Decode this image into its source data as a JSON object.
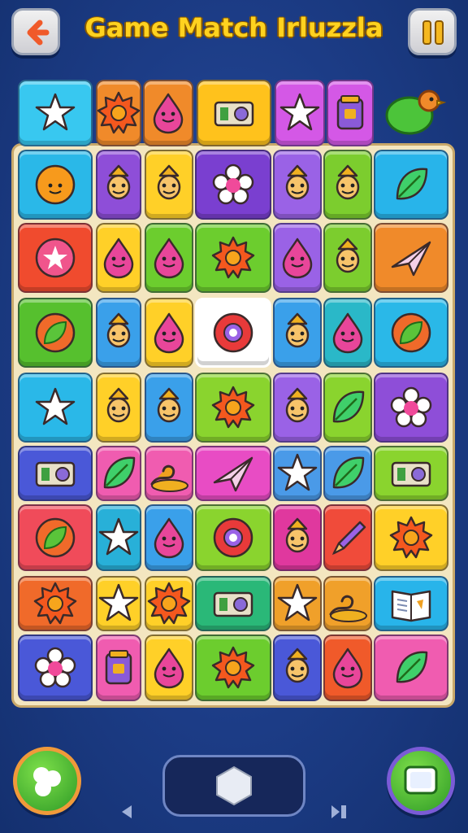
{
  "header": {
    "title": "Game Match Irluzzla",
    "back_icon": "back-arrow-icon",
    "pause_icon": "pause-icon"
  },
  "colors": {
    "background": "#1c3c86",
    "title": "#ffd21f",
    "board": "#f3e6c0"
  },
  "tiles": [
    {
      "row": 0,
      "items": [
        {
          "color": "#38c8f0",
          "icon": "star"
        },
        {
          "color": "#f08a2a",
          "icon": "sun"
        },
        {
          "color": "#f08a2a",
          "icon": "drop"
        },
        {
          "color": "#ffc21c",
          "icon": "camera"
        },
        {
          "color": "#d458e6",
          "icon": "star"
        },
        {
          "color": "#d458e6",
          "icon": "jar"
        }
      ]
    },
    {
      "row": 1,
      "items": [
        {
          "color": "#2ab8e8",
          "icon": "smile"
        },
        {
          "color": "#8e4ed8",
          "icon": "figure"
        },
        {
          "color": "#ffd028",
          "icon": "figure"
        },
        {
          "color": "#7a3fd0",
          "icon": "flower"
        },
        {
          "color": "#9a62e6",
          "icon": "figure"
        },
        {
          "color": "#7ccd2e",
          "icon": "figure"
        },
        {
          "color": "#28b4ea",
          "icon": "leaf"
        }
      ]
    },
    {
      "row": 2,
      "items": [
        {
          "color": "#f04b2e",
          "icon": "star-circle"
        },
        {
          "color": "#ffd028",
          "icon": "drop"
        },
        {
          "color": "#6ccd2e",
          "icon": "drop"
        },
        {
          "color": "#6ccd2e",
          "icon": "sun"
        },
        {
          "color": "#9a62e6",
          "icon": "drop"
        },
        {
          "color": "#7ccd2e",
          "icon": "figure"
        },
        {
          "color": "#f08a2a",
          "icon": "plane"
        }
      ]
    },
    {
      "row": 3,
      "items": [
        {
          "color": "#56c02e",
          "icon": "leaf-circle"
        },
        {
          "color": "#3aa0ea",
          "icon": "figure"
        },
        {
          "color": "#ffd028",
          "icon": "drop"
        },
        {
          "color": "#ffffff",
          "icon": "donut",
          "highlight": true
        },
        {
          "color": "#3aa0ea",
          "icon": "figure"
        },
        {
          "color": "#2ab8c8",
          "icon": "drop"
        },
        {
          "color": "#2ab8e8",
          "icon": "leaf-circle"
        }
      ]
    },
    {
      "row": 4,
      "items": [
        {
          "color": "#2ab8e8",
          "icon": "star"
        },
        {
          "color": "#ffd028",
          "icon": "figure"
        },
        {
          "color": "#3aa0ea",
          "icon": "figure"
        },
        {
          "color": "#8ad42e",
          "icon": "sun"
        },
        {
          "color": "#9a62e6",
          "icon": "figure"
        },
        {
          "color": "#8ad42e",
          "icon": "leaf"
        },
        {
          "color": "#8e4ed8",
          "icon": "flower"
        }
      ]
    },
    {
      "row": 5,
      "items": [
        {
          "color": "#4a58d8",
          "icon": "camera"
        },
        {
          "color": "#f05cb0",
          "icon": "leaf"
        },
        {
          "color": "#f05cb0",
          "icon": "swirl"
        },
        {
          "color": "#e84cc4",
          "icon": "plane"
        },
        {
          "color": "#4a9ae8",
          "icon": "star"
        },
        {
          "color": "#4a9ae8",
          "icon": "leaf"
        },
        {
          "color": "#8ad42e",
          "icon": "camera"
        }
      ]
    },
    {
      "row": 6,
      "items": [
        {
          "color": "#f04b5a",
          "icon": "leaf-circle"
        },
        {
          "color": "#28b0d8",
          "icon": "star"
        },
        {
          "color": "#3aa0ea",
          "icon": "drop"
        },
        {
          "color": "#8ad42e",
          "icon": "donut"
        },
        {
          "color": "#e0389e",
          "icon": "figure"
        },
        {
          "color": "#f04b3a",
          "icon": "pencil"
        },
        {
          "color": "#ffd028",
          "icon": "sun"
        }
      ]
    },
    {
      "row": 7,
      "items": [
        {
          "color": "#f06a2a",
          "icon": "sun"
        },
        {
          "color": "#ffd028",
          "icon": "star"
        },
        {
          "color": "#ffd028",
          "icon": "sun"
        },
        {
          "color": "#2ab878",
          "icon": "camera"
        },
        {
          "color": "#f0a02a",
          "icon": "star"
        },
        {
          "color": "#f0a02a",
          "icon": "swirl"
        },
        {
          "color": "#28b4ea",
          "icon": "book"
        }
      ]
    },
    {
      "row": 8,
      "items": [
        {
          "color": "#4a58d8",
          "icon": "flower"
        },
        {
          "color": "#f05cb0",
          "icon": "jar"
        },
        {
          "color": "#ffd028",
          "icon": "drop"
        },
        {
          "color": "#6ccd2e",
          "icon": "sun"
        },
        {
          "color": "#4a58d8",
          "icon": "figure"
        },
        {
          "color": "#f05a2a",
          "icon": "drop"
        },
        {
          "color": "#f05cb0",
          "icon": "leaf"
        }
      ]
    }
  ],
  "controls": {
    "shuffle_icon": "shuffle-icon",
    "hint_icon": "hint-icon",
    "center_icon": "hexagon-icon",
    "prev_icon": "prev-arrow-icon",
    "next_icon": "next-arrow-icon"
  }
}
